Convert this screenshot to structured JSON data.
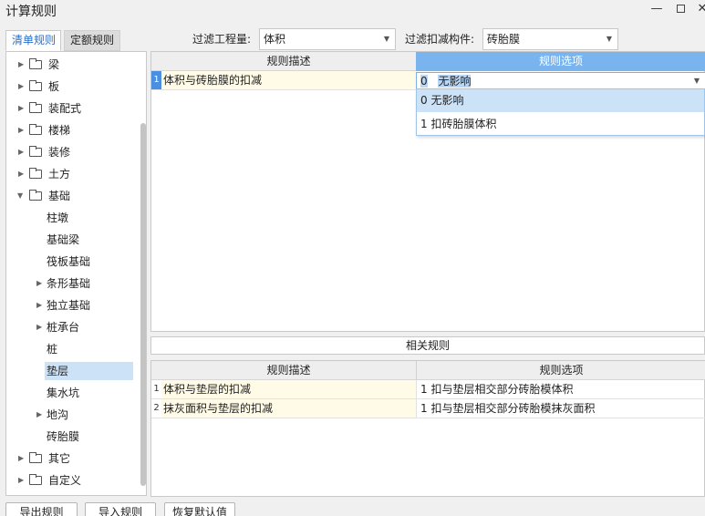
{
  "window": {
    "title": "计算规则",
    "minimize": "—",
    "close": "✕"
  },
  "tabs": [
    {
      "label": "清单规则",
      "active": true
    },
    {
      "label": "定额规则",
      "active": false
    }
  ],
  "filters": {
    "quantity_label": "过滤工程量:",
    "quantity_value": "体积",
    "component_label": "过滤扣减构件:",
    "component_value": "砖胎膜"
  },
  "tree": [
    {
      "label": "梁",
      "level": 0,
      "type": "folder",
      "expand": "collapsed"
    },
    {
      "label": "板",
      "level": 0,
      "type": "folder",
      "expand": "collapsed"
    },
    {
      "label": "装配式",
      "level": 0,
      "type": "folder",
      "expand": "collapsed"
    },
    {
      "label": "楼梯",
      "level": 0,
      "type": "folder",
      "expand": "collapsed"
    },
    {
      "label": "装修",
      "level": 0,
      "type": "folder",
      "expand": "collapsed"
    },
    {
      "label": "土方",
      "level": 0,
      "type": "folder",
      "expand": "collapsed"
    },
    {
      "label": "基础",
      "level": 0,
      "type": "folder",
      "expand": "expanded"
    },
    {
      "label": "柱墩",
      "level": 1,
      "type": "leaf"
    },
    {
      "label": "基础梁",
      "level": 1,
      "type": "leaf"
    },
    {
      "label": "筏板基础",
      "level": 1,
      "type": "leaf"
    },
    {
      "label": "条形基础",
      "level": 1,
      "type": "node",
      "expand": "collapsed"
    },
    {
      "label": "独立基础",
      "level": 1,
      "type": "node",
      "expand": "collapsed"
    },
    {
      "label": "桩承台",
      "level": 1,
      "type": "node",
      "expand": "collapsed"
    },
    {
      "label": "桩",
      "level": 1,
      "type": "leaf"
    },
    {
      "label": "垫层",
      "level": 1,
      "type": "leaf",
      "selected": true
    },
    {
      "label": "集水坑",
      "level": 1,
      "type": "leaf"
    },
    {
      "label": "地沟",
      "level": 1,
      "type": "node",
      "expand": "collapsed"
    },
    {
      "label": "砖胎膜",
      "level": 1,
      "type": "leaf"
    },
    {
      "label": "其它",
      "level": 0,
      "type": "folder",
      "expand": "collapsed"
    },
    {
      "label": "自定义",
      "level": 0,
      "type": "folder",
      "expand": "collapsed"
    }
  ],
  "rules_grid": {
    "col_desc": "规则描述",
    "col_option": "规则选项",
    "rows": [
      {
        "num": "1",
        "desc": "体积与砖胎膜的扣减",
        "option_code": "0",
        "option_text": "无影响"
      }
    ]
  },
  "dropdown": {
    "options": [
      {
        "label": "0  无影响",
        "highlighted": true
      },
      {
        "label": "1 扣砖胎膜体积",
        "highlighted": false
      }
    ]
  },
  "related": {
    "title": "相关规则",
    "col_desc": "规则描述",
    "col_option": "规则选项",
    "rows": [
      {
        "num": "1",
        "desc": "体积与垫层的扣减",
        "option": "1 扣与垫层相交部分砖胎模体积"
      },
      {
        "num": "2",
        "desc": "抹灰面积与垫层的扣减",
        "option": "1 扣与垫层相交部分砖胎模抹灰面积"
      }
    ]
  },
  "buttons": {
    "export": "导出规则",
    "import": "导入规则",
    "restore": "恢复默认值"
  },
  "colors": {
    "accent": "#2a6ec6",
    "header_active": "#79b4ee",
    "selection": "#cce2f7",
    "desc_cell": "#fffbe6"
  }
}
